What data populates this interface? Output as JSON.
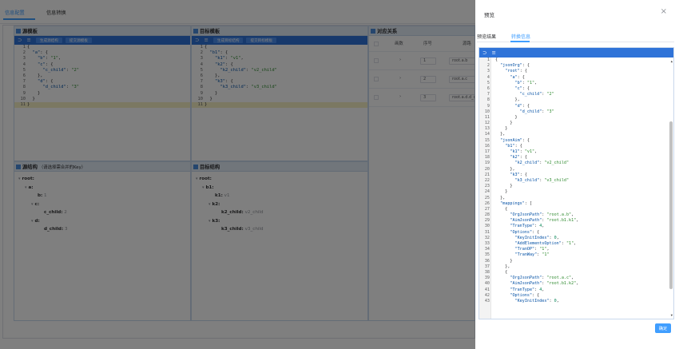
{
  "top_tabs": [
    {
      "label": "信息配置"
    },
    {
      "label": "信息转换"
    }
  ],
  "source_panel": {
    "title": "源模板",
    "buttons": [
      "生成源结构",
      "提交源模板"
    ],
    "lines": [
      "{",
      "  \"a\": {",
      "    \"b\": \"1\",",
      "    \"c\": {",
      "      \"c_child\": \"2\"",
      "    },",
      "    \"d\": {",
      "      \"d_child\": \"3\"",
      "    }",
      "  }",
      "}"
    ]
  },
  "target_panel": {
    "title": "目标模板",
    "buttons": [
      "生成目标结构",
      "提交目标模板"
    ],
    "lines": [
      "{",
      "  \"b1\": {",
      "    \"k1\": \"v1\",",
      "    \"k2\": {",
      "      \"k2_child\": \"v2_child\"",
      "    },",
      "    \"k3\": {",
      "      \"k3_child\": \"v3_child\"",
      "    }",
      "  }",
      "}"
    ]
  },
  "mapping_panel": {
    "title": "对应关系",
    "columns": [
      "",
      "画数",
      "序号",
      "源路"
    ],
    "rows": [
      {
        "order": "1",
        "path": "root.a.b"
      },
      {
        "order": "2",
        "path": "root.a.c"
      },
      {
        "order": "3",
        "path": "root.a.d.d_ch"
      }
    ]
  },
  "source_structure": {
    "title": "源结构",
    "note": "（请选择需合并的Key）",
    "nodes": [
      {
        "indent": 0,
        "key": "root:",
        "val": "",
        "arrow": true
      },
      {
        "indent": 1,
        "key": "a:",
        "val": "",
        "arrow": true
      },
      {
        "indent": 2,
        "key": "b:",
        "val": "1",
        "arrow": false
      },
      {
        "indent": 2,
        "key": "c:",
        "val": "",
        "arrow": true
      },
      {
        "indent": 3,
        "key": "c_child:",
        "val": "2",
        "arrow": false
      },
      {
        "indent": 2,
        "key": "d:",
        "val": "",
        "arrow": true
      },
      {
        "indent": 3,
        "key": "d_child:",
        "val": "3",
        "arrow": false
      }
    ]
  },
  "target_structure": {
    "title": "目标结构",
    "nodes": [
      {
        "indent": 0,
        "key": "root:",
        "val": "",
        "arrow": true
      },
      {
        "indent": 1,
        "key": "b1:",
        "val": "",
        "arrow": true
      },
      {
        "indent": 2,
        "key": "k1:",
        "val": "v1",
        "arrow": false
      },
      {
        "indent": 2,
        "key": "k2:",
        "val": "",
        "arrow": true
      },
      {
        "indent": 3,
        "key": "k2_child:",
        "val": "v2_child",
        "arrow": false
      },
      {
        "indent": 2,
        "key": "k3:",
        "val": "",
        "arrow": true
      },
      {
        "indent": 3,
        "key": "k3_child:",
        "val": "v3_child",
        "arrow": false
      }
    ]
  },
  "drawer": {
    "title": "预览",
    "close_glyph": "×",
    "tabs": [
      {
        "label": "预览结果"
      },
      {
        "label": "转换信息"
      }
    ],
    "json_lines": [
      "{",
      "  \"jsonOrg\": {",
      "    \"root\": {",
      "      \"a\": {",
      "        \"b\": \"1\",",
      "        \"c\": {",
      "          \"c_child\": \"2\"",
      "        },",
      "        \"d\": {",
      "          \"d_child\": \"3\"",
      "        }",
      "      }",
      "    }",
      "  },",
      "  \"jsonAim\": {",
      "    \"b1\": {",
      "      \"k1\": \"v1\",",
      "      \"k2\": {",
      "        \"k2_child\": \"v2_child\"",
      "      },",
      "      \"k3\": {",
      "        \"k3_child\": \"v3_child\"",
      "      }",
      "    }",
      "  },",
      "  \"mappings\": [",
      "    {",
      "      \"OrgJsonPath\": \"root.a.b\",",
      "      \"AimJsonPath\": \"root.b1.k1\",",
      "      \"TranType\": 4,",
      "      \"Options\": {",
      "        \"KeyInitIndex\": 0,",
      "        \"AddElementsOption\": \"1\",",
      "        \"TranOP\": \"1\",",
      "        \"TranWay\": \"1\"",
      "      }",
      "    },",
      "    {",
      "      \"OrgJsonPath\": \"root.a.c\",",
      "      \"AimJsonPath\": \"root.b1.k2\",",
      "      \"TranType\": 4,",
      "      \"Options\": {",
      "        \"KeyInitIndex\": 0,"
    ],
    "ok_label": "确定"
  },
  "colors": {
    "accent": "#409eff",
    "toolbar": "#2f73d8",
    "panel_header": "#e3ecf7",
    "overlay": "rgba(0,0,0,0.5)"
  }
}
